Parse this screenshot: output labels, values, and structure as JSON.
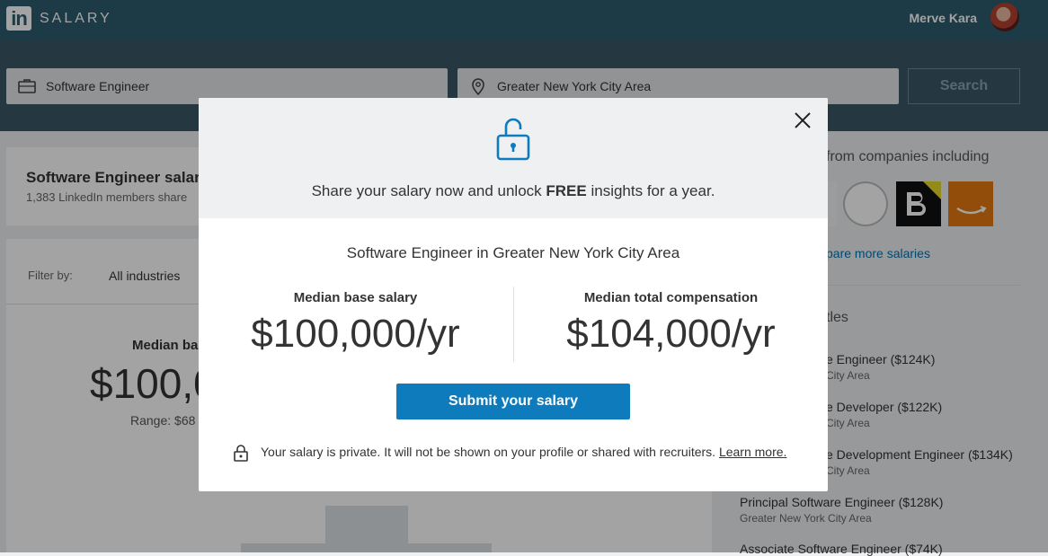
{
  "header": {
    "logo_text": "in",
    "brand": "SALARY",
    "user_name": "Merve Kara"
  },
  "search": {
    "title_value": "Software Engineer",
    "location_value": "Greater New York City Area",
    "button_label": "Search"
  },
  "background": {
    "title": "Software Engineer salar",
    "subtitle": "1,383 LinkedIn members share",
    "filter_label": "Filter by:",
    "filter_value": "All industries",
    "median_label": "Median ba",
    "median_value": "$100,0",
    "range_label": "Range: $68",
    "sidebar_text": "from companies including",
    "sidebar_link": "pare more salaries",
    "sidebar_heading": "tles",
    "jobs": [
      {
        "title": "e Engineer ($124K)",
        "location": "City Area"
      },
      {
        "title": "e Developer ($122K)",
        "location": "City Area"
      },
      {
        "title": "e Development Engineer ($134K)",
        "location": "City Area"
      },
      {
        "title": "Principal Software Engineer ($128K)",
        "location": "Greater New York City Area"
      },
      {
        "title": "Associate Software Engineer ($74K)",
        "location": ""
      }
    ]
  },
  "modal": {
    "promo_before": "Share your salary now and unlock ",
    "promo_bold": "FREE",
    "promo_after": " insights for a year.",
    "context": "Software Engineer in Greater New York City Area",
    "base_label": "Median base salary",
    "base_value": "$100,000/yr",
    "total_label": "Median total compensation",
    "total_value": "$104,000/yr",
    "submit_label": "Submit your salary",
    "privacy_text": "Your salary is private. It will not be shown on your profile or shared with recruiters. ",
    "privacy_link": "Learn more."
  },
  "colors": {
    "brand": "#2e5b6f",
    "primary_button": "#0e7bbd",
    "link": "#0073b1"
  },
  "icons": [
    "briefcase-icon",
    "location-pin-icon",
    "unlock-icon",
    "close-icon",
    "lock-icon"
  ]
}
